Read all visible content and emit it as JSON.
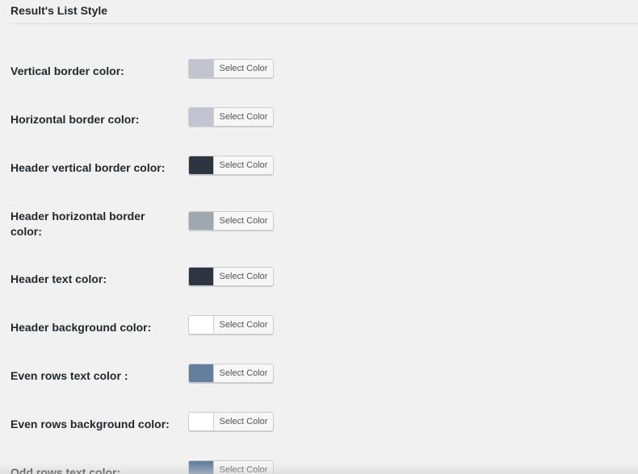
{
  "section": {
    "title": "Result's List Style"
  },
  "button_label": "Select Color",
  "settings": [
    {
      "label": "Vertical border color:",
      "color": "#c3c4d0"
    },
    {
      "label": "Horizontal border color:",
      "color": "#c3c4d0"
    },
    {
      "label": "Header vertical border color:",
      "color": "#2e3440"
    },
    {
      "label": "Header horizontal border color:",
      "color": "#a0a7ae"
    },
    {
      "label": "Header text color:",
      "color": "#2e3440"
    },
    {
      "label": "Header background color:",
      "color": "#ffffff"
    },
    {
      "label": "Even rows text color :",
      "color": "#647f9c"
    },
    {
      "label": "Even rows background color:",
      "color": "#ffffff"
    },
    {
      "label": "Odd rows text color:",
      "color": "#647f9c"
    }
  ]
}
